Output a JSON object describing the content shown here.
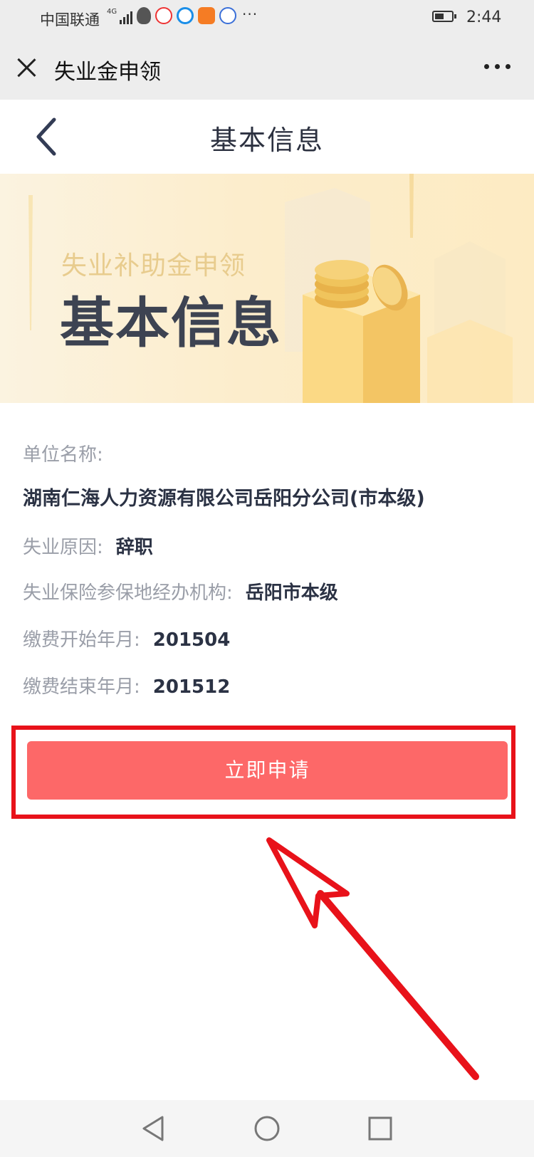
{
  "status_bar": {
    "carrier": "中国联通",
    "network": "4G",
    "more": "···",
    "time": "2:44"
  },
  "title_bar": {
    "title": "失业金申领"
  },
  "page_header": {
    "title": "基本信息"
  },
  "banner": {
    "subtitle": "失业补助金申领",
    "title": "基本信息"
  },
  "info": {
    "company_label": "单位名称:",
    "company_value": "湖南仁海人力资源有限公司岳阳分公司(市本级)",
    "reason_label": "失业原因:",
    "reason_value": "辞职",
    "agency_label": "失业保险参保地经办机构:",
    "agency_value": "岳阳市本级",
    "start_label": "缴费开始年月:",
    "start_value": "201504",
    "end_label": "缴费结束年月:",
    "end_value": "201512"
  },
  "actions": {
    "apply_label": "立即申请"
  },
  "colors": {
    "accent": "#fd6868",
    "highlight": "#e8121a"
  }
}
